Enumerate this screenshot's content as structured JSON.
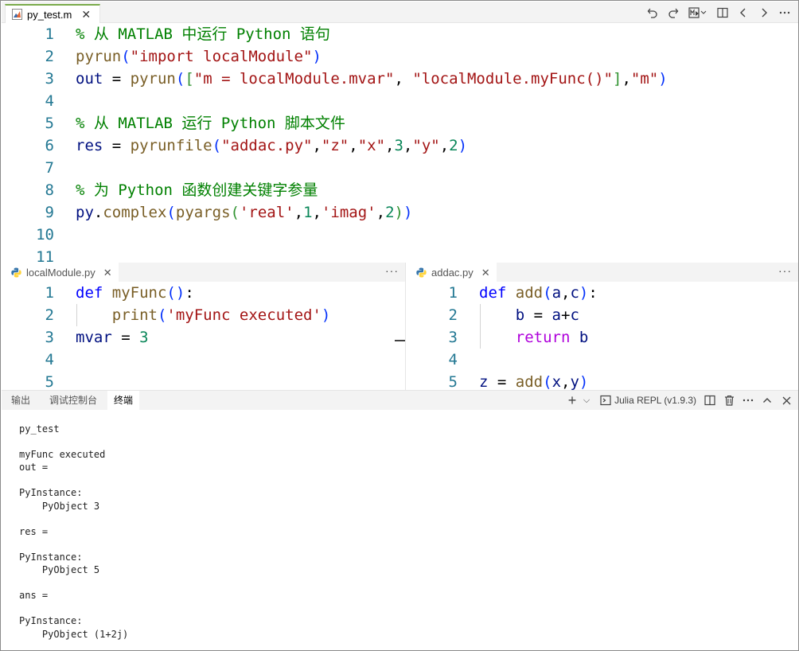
{
  "main_tab": {
    "label": "py_test.m",
    "close": "✕"
  },
  "toolbar": {
    "icons": [
      "undo-icon",
      "redo-icon",
      "run-matlab-icon",
      "split-editor-icon",
      "back-icon",
      "forward-icon",
      "more-icon"
    ]
  },
  "main_editor": {
    "line_numbers": [
      "1",
      "2",
      "3",
      "4",
      "5",
      "6",
      "7",
      "8",
      "9",
      "10",
      "11"
    ],
    "line1": {
      "c": "% 从 MATLAB 中运行 Python 语句"
    },
    "line2": {
      "f": "pyrun",
      "p": "(",
      "s": "\"import localModule\"",
      "pc": ")"
    },
    "line3": {
      "v": "out",
      "eq": " = ",
      "f": "pyrun",
      "p": "(",
      "b": "[",
      "s1": "\"m = localModule.mvar\"",
      "c1": ", ",
      "s2": "\"localModule.myFunc()\"",
      "bc": "]",
      "c2": ",",
      "s3": "\"m\"",
      "pc": ")"
    },
    "line5": {
      "c": "% 从 MATLAB 运行 Python 脚本文件"
    },
    "line6": {
      "v": "res",
      "eq": " = ",
      "f": "pyrunfile",
      "p": "(",
      "s1": "\"addac.py\"",
      "c1": ",",
      "s2": "\"z\"",
      "c2": ",",
      "s3": "\"x\"",
      "c3": ",",
      "n1": "3",
      "c4": ",",
      "s4": "\"y\"",
      "c5": ",",
      "n2": "2",
      "pc": ")"
    },
    "line8": {
      "c": "% 为 Python 函数创建关键字参量"
    },
    "line9": {
      "v": "py",
      "dot": ".",
      "f1": "complex",
      "p": "(",
      "f2": "pyargs",
      "p2": "(",
      "s1": "'real'",
      "c1": ",",
      "n1": "1",
      "c2": ",",
      "s2": "'imag'",
      "c3": ",",
      "n2": "2",
      "p2c": ")",
      "pc": ")"
    }
  },
  "left_pane": {
    "tab_label": "localModule.py",
    "close": "✕",
    "more": "···",
    "line_numbers": [
      "1",
      "2",
      "3",
      "4",
      "5"
    ],
    "line1": {
      "kw": "def",
      "sp": " ",
      "f": "myFunc",
      "p": "()",
      "colon": ":"
    },
    "line2": {
      "ind": "    ",
      "f": "print",
      "p": "(",
      "s": "'myFunc executed'",
      "pc": ")"
    },
    "line3": {
      "v": "mvar",
      "eq": " = ",
      "n": "3"
    }
  },
  "right_pane": {
    "tab_label": "addac.py",
    "close": "✕",
    "more": "···",
    "line_numbers": [
      "1",
      "2",
      "3",
      "4",
      "5"
    ],
    "line1": {
      "kw": "def",
      "sp": " ",
      "f": "add",
      "p": "(",
      "a1": "a",
      "c": ",",
      "a2": "c",
      "pc": ")",
      "colon": ":"
    },
    "line2": {
      "ind": "    ",
      "v1": "b",
      "eq": " = ",
      "v2": "a",
      "op": "+",
      "v3": "c"
    },
    "line3": {
      "ind": "    ",
      "kw": "return",
      "sp": " ",
      "v": "b"
    },
    "line5": {
      "v": "z",
      "eq": " = ",
      "f": "add",
      "p": "(",
      "a1": "x",
      "c": ",",
      "a2": "y",
      "pc": ")"
    }
  },
  "panel": {
    "tabs": [
      "输出",
      "调试控制台",
      "终端"
    ],
    "active_tab": "终端",
    "new_terminal": "+",
    "dropdown": "⌵",
    "repl_label": "Julia REPL (v1.9.3)",
    "terminal_output": "py_test\n\nmyFunc executed\nout =\n\nPyInstance:\n    PyObject 3\n\nres =\n\nPyInstance:\n    PyObject 5\n\nans =\n\nPyInstance:\n    PyObject (1+2j)"
  }
}
